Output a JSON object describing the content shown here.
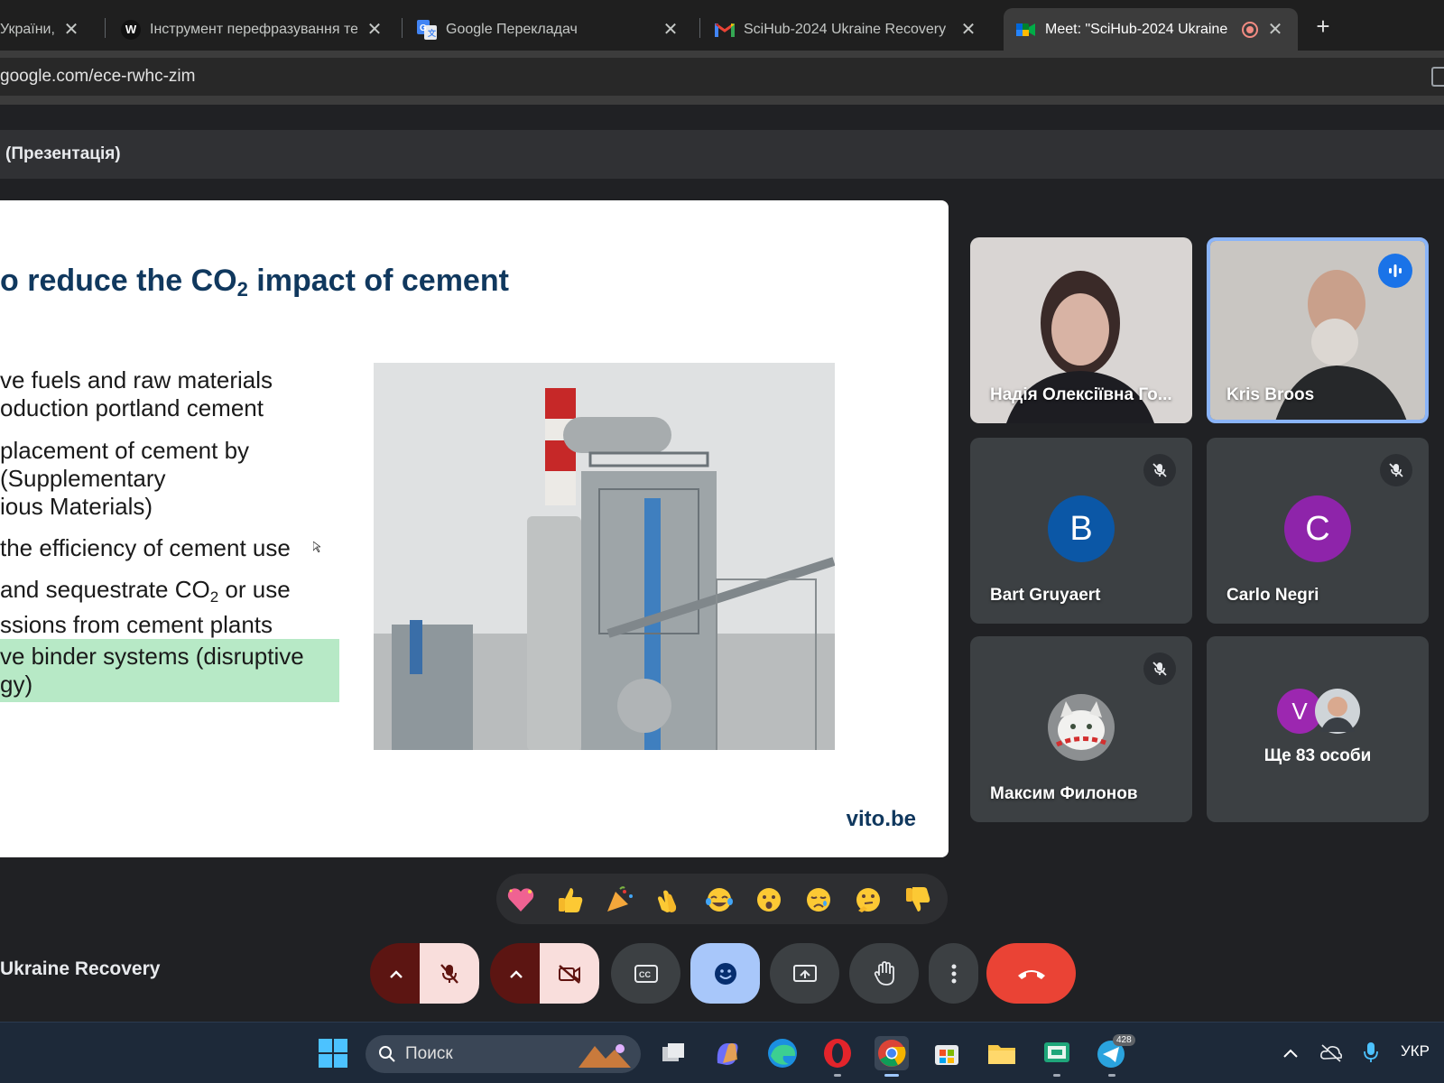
{
  "browser": {
    "tabs": [
      {
        "title": "України, с",
        "favicon": "ukraine-site-icon"
      },
      {
        "title": "Інструмент перефразування те",
        "favicon": "paraphrase-tool-icon"
      },
      {
        "title": "Google Перекладач",
        "favicon": "google-translate-icon"
      },
      {
        "title": "SciHub-2024 Ukraine Recovery",
        "favicon": "gmail-icon"
      },
      {
        "title": "Meet: \"SciHub-2024 Ukraine",
        "favicon": "google-meet-icon",
        "active": true,
        "recording": true
      }
    ],
    "url": "google.com/ece-rwhc-zim"
  },
  "meet": {
    "presentation_label": "(Презентація)",
    "slide": {
      "title_part1": "o reduce the CO",
      "title_sub": "2",
      "title_part2": " impact of cement",
      "bullets": {
        "b1_line1": "ve fuels and  raw materials",
        "b1_line2": "oduction portland cement",
        "b2_line1": "placement of cement by",
        "b2_line2": "(Supplementary",
        "b2_line3": "ious Materials)",
        "b3_line1": "the efficiency of cement use",
        "b4_line1a": "and sequestrate CO",
        "b4_sub": "2",
        "b4_line1b": " or use",
        "b4_line2": "ssions from cement plants",
        "b5_line1": "ve binder systems (disruptive",
        "b5_line2": "gy)"
      },
      "highlight_color": "#b7e9c6",
      "footer": "vito.be"
    },
    "participants": [
      {
        "name": "Надія Олексіївна Го...",
        "video": true
      },
      {
        "name": "Kris Broos",
        "video": true,
        "speaking": true
      },
      {
        "name": "Bart Gruyaert",
        "initial": "B",
        "avatar_color": "#0b57a6",
        "muted": true
      },
      {
        "name": "Carlo Negri",
        "initial": "C",
        "avatar_color": "#8e24aa",
        "muted": true
      },
      {
        "name": "Максим Филонов",
        "muted": true
      },
      {
        "name": "Ще 83 особи",
        "initial": "V",
        "avatar_color": "#9c27b0"
      }
    ],
    "reactions": [
      "sparkling-heart",
      "thumbs-up",
      "party-popper",
      "clapping-hands",
      "tears-of-joy",
      "astonished",
      "crying",
      "thinking",
      "thumbs-down"
    ],
    "meeting_name": "Ukraine Recovery"
  },
  "taskbar": {
    "search_placeholder": "Поиск",
    "telegram_badge": "428",
    "language": "УКР"
  },
  "colors": {
    "end_call": "#ea4335",
    "active_speaker": "#8ab4f8",
    "slide_title": "#10385e"
  }
}
